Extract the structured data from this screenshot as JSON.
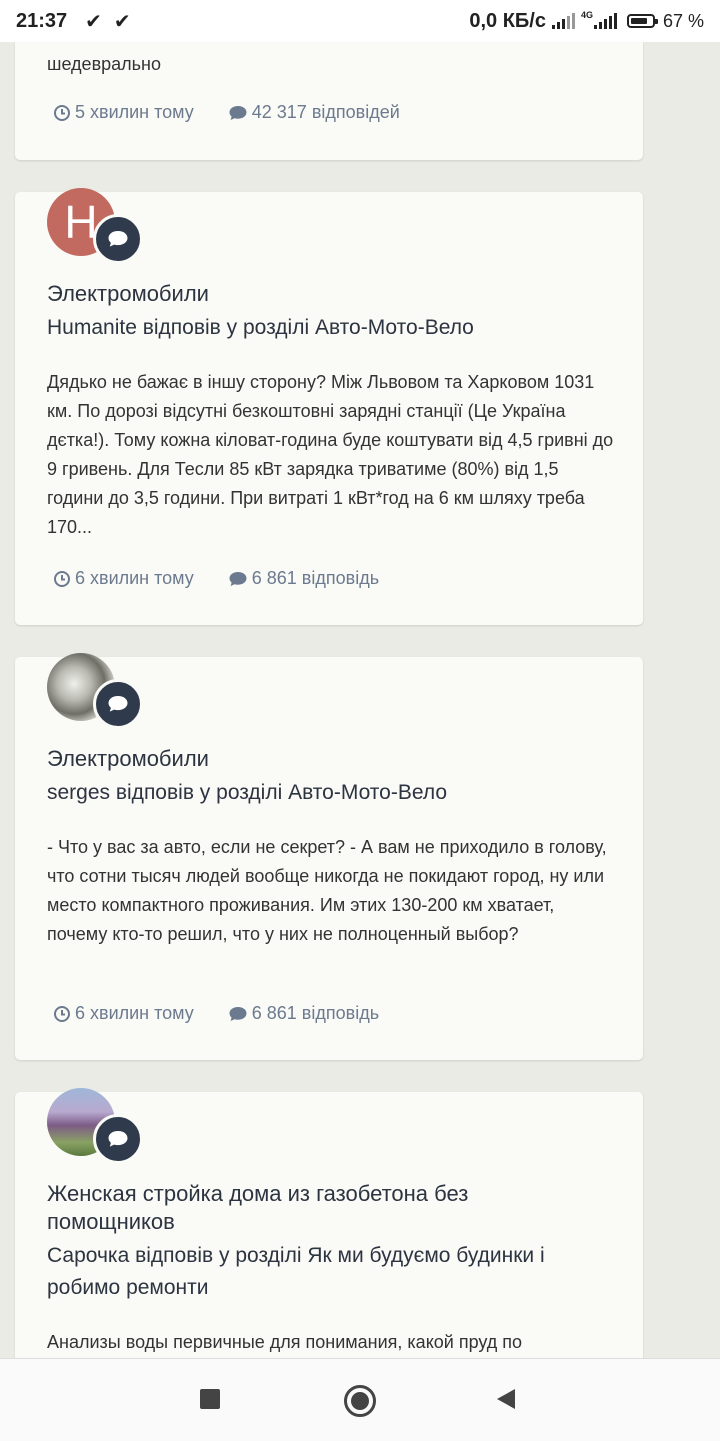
{
  "status_bar": {
    "time": "21:37",
    "notifications": [
      "✔",
      "✔"
    ],
    "net_speed": "0,0 КБ/с",
    "network_type": "4G",
    "battery": "67 %"
  },
  "cards": [
    {
      "body_tail": "шедеврально",
      "time": "5 хвилин тому",
      "replies": "42 317 відповідей"
    },
    {
      "avatar_letter": "H",
      "avatar_color": "#c26a60",
      "badge_icon": "comment-icon",
      "title": "Электромобили",
      "subtitle": "Humanite відповів у розділі Авто-Мото-Вело",
      "body": "Дядько не бажає в іншу сторону? Між Львовом та Харковом 1031 км. По дорозі відсутні безкоштовні зарядні станції (Це Україна дєтка!). Тому кожна кіловат-година буде коштувати від 4,5 гривні до 9 гривень. Для Тесли 85 кВт зарядка триватиме (80%) від 1,5 години до 3,5 години. При витраті 1 кВт*год на 6 км шляху треба 170...",
      "time": "6 хвилин тому",
      "replies": "6 861 відповідь"
    },
    {
      "badge_icon": "comment-icon",
      "title": "Электромобили",
      "subtitle": "serges відповів у розділі Авто-Мото-Вело",
      "body": "- Что у вас за авто, если не секрет? - А вам не приходило в голову, что сотни тысяч людей вообще никогда не покидают город, ну или место компактного проживания. Им этих 130-200 км хватает, почему кто-то решил, что у них не полноценный выбор?",
      "time": "6 хвилин тому",
      "replies": "6 861 відповідь"
    },
    {
      "badge_icon": "comment-icon",
      "title": "Женская стройка дома из газобетона без помощников",
      "subtitle": "Сарочка відповів у розділі Як ми будуємо будинки і робимо ремонти",
      "body": "Анализы воды первичные для понимания, какой пруд по"
    }
  ],
  "colors": {
    "background": "#ebebe5",
    "card": "#fafaf6",
    "badge": "#2f3b4d",
    "meta_text": "#6c7a8f",
    "title_text": "#2d3441"
  },
  "nav_bar": {
    "buttons": [
      "recents-square-icon",
      "home-circle-icon",
      "back-triangle-icon"
    ]
  }
}
